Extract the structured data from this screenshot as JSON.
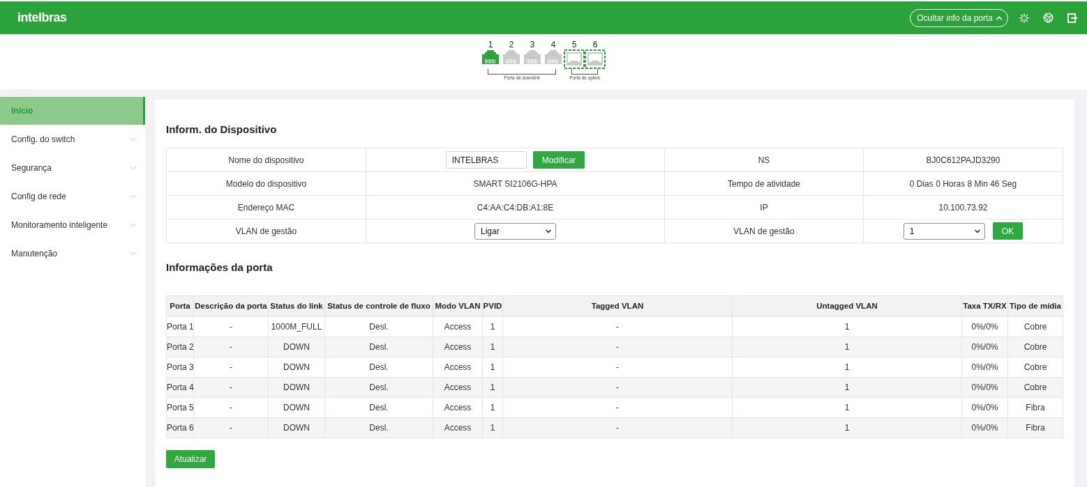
{
  "header": {
    "logo": "intelbras",
    "port_info_toggle": {
      "label": "Ocultar info da porta",
      "expanded": true
    }
  },
  "port_panel": {
    "groups": [
      {
        "label": "Porta de downlink",
        "ports": [
          {
            "number": "1",
            "kind": "rj45",
            "link_up": true
          },
          {
            "number": "2",
            "kind": "rj45",
            "link_up": false
          },
          {
            "number": "3",
            "kind": "rj45",
            "link_up": false
          },
          {
            "number": "4",
            "kind": "rj45",
            "link_up": false
          }
        ]
      },
      {
        "label": "Porta de uplink",
        "ports": [
          {
            "number": "5",
            "kind": "sfp",
            "link_up": false
          },
          {
            "number": "6",
            "kind": "sfp",
            "link_up": false
          }
        ]
      }
    ]
  },
  "sidebar": {
    "items": [
      {
        "label": "Início",
        "selected": true,
        "expandable": false
      },
      {
        "label": "Config. do switch",
        "selected": false,
        "expandable": true
      },
      {
        "label": "Segurança",
        "selected": false,
        "expandable": true
      },
      {
        "label": "Config de rede",
        "selected": false,
        "expandable": true
      },
      {
        "label": "Monitoramento inteligente",
        "selected": false,
        "expandable": true
      },
      {
        "label": "Manutenção",
        "selected": false,
        "expandable": true
      }
    ]
  },
  "device_info": {
    "title": "Inform. do Dispositivo",
    "fields": [
      {
        "label": "Nome do dispositivo",
        "kind": "input",
        "value": "INTELBRAS",
        "button": "Modificar"
      },
      {
        "label": "NS",
        "kind": "text",
        "value": "BJ0C612PAJD3290"
      },
      {
        "label": "Modelo do dispositivo",
        "kind": "text",
        "value": "SMART SI2106G-HPA"
      },
      {
        "label": "Tempo de atividade",
        "kind": "text",
        "value": "0 Dias 0 Horas 8 Min 46 Seg"
      },
      {
        "label": "Endereço MAC",
        "kind": "text",
        "value": "C4:AA:C4:DB:A1:8E"
      },
      {
        "label": "IP",
        "kind": "text",
        "value": "10.100.73.92"
      },
      {
        "label": "VLAN de gestão",
        "kind": "select",
        "value": "Ligar"
      },
      {
        "label": "VLAN de gestão",
        "kind": "select",
        "value": "1",
        "button": "OK"
      }
    ]
  },
  "port_info": {
    "title": "Informações da porta",
    "table": {
      "columns": [
        "Porta",
        "Descrição da porta",
        "Status do link",
        "Status de controle de fluxo",
        "Modo VLAN",
        "PVID",
        "Tagged VLAN",
        "Untagged VLAN",
        "Taxa TX/RX",
        "Tipo de mídia"
      ],
      "rows": [
        [
          "Porta 1",
          "-",
          "1000M_FULL",
          "Desl.",
          "Access",
          "1",
          "-",
          "1",
          "0%/0%",
          "Cobre"
        ],
        [
          "Porta 2",
          "-",
          "DOWN",
          "Desl.",
          "Access",
          "1",
          "-",
          "1",
          "0%/0%",
          "Cobre"
        ],
        [
          "Porta 3",
          "-",
          "DOWN",
          "Desl.",
          "Access",
          "1",
          "-",
          "1",
          "0%/0%",
          "Cobre"
        ],
        [
          "Porta 4",
          "-",
          "DOWN",
          "Desl.",
          "Access",
          "1",
          "-",
          "1",
          "0%/0%",
          "Cobre"
        ],
        [
          "Porta 5",
          "-",
          "DOWN",
          "Desl.",
          "Access",
          "1",
          "-",
          "1",
          "0%/0%",
          "Fibra"
        ],
        [
          "Porta 6",
          "-",
          "DOWN",
          "Desl.",
          "Access",
          "1",
          "-",
          "1",
          "0%/0%",
          "Fibra"
        ]
      ]
    },
    "refresh_button": "Atualizar"
  }
}
